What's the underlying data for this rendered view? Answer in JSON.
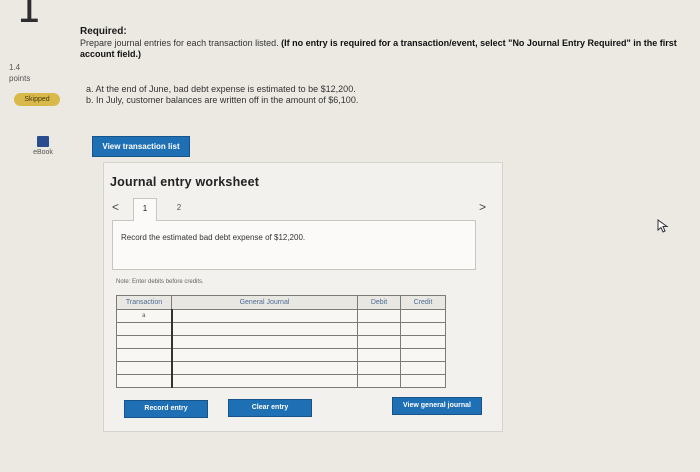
{
  "question": {
    "number": "1",
    "points_value": "1.4",
    "points_label": "points",
    "status_badge": "Skipped",
    "ebook_label": "eBook"
  },
  "prompt": {
    "required_label": "Required:",
    "instruction_text": "Prepare journal entries for each transaction listed. ",
    "instruction_bold": "(If no entry is required for a transaction/event, select \"No Journal Entry Required\" in the first account field.)",
    "items": [
      "a. At the end of June, bad debt expense is estimated to be $12,200.",
      "b. In July, customer balances are written off in the amount of $6,100."
    ]
  },
  "view_transaction_list_label": "View transaction list",
  "worksheet": {
    "title": "Journal entry worksheet",
    "nav_prev": "<",
    "nav_next": ">",
    "tabs": [
      "1",
      "2"
    ],
    "description": "Record the estimated bad debt expense of $12,200.",
    "note": "Note: Enter debits before credits.",
    "columns": [
      "Transaction",
      "General Journal",
      "Debit",
      "Credit"
    ],
    "rows": [
      {
        "transaction": "a"
      },
      {
        "transaction": ""
      },
      {
        "transaction": ""
      },
      {
        "transaction": ""
      },
      {
        "transaction": ""
      },
      {
        "transaction": ""
      }
    ],
    "record_entry_label": "Record entry",
    "clear_entry_label": "Clear entry",
    "view_general_journal_label": "View general journal"
  },
  "colors": {
    "button_blue": "#1f6fb5",
    "skipped_badge": "#d8b94a",
    "column_header_text": "#4d6c96"
  }
}
